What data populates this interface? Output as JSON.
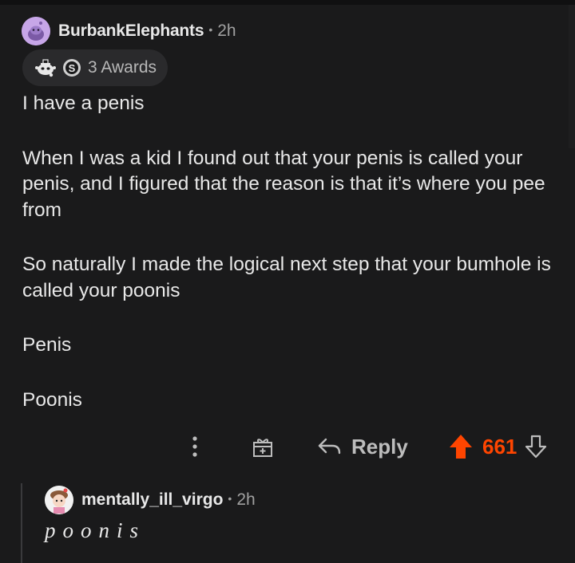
{
  "post": {
    "author": "BurbankElephants",
    "separator": "•",
    "time": "2h",
    "awards_label": "3 Awards",
    "paragraphs": [
      "I have a penis",
      "When I was a kid I found out that your penis is called your penis, and I figured that the reason is that it’s where you pee from",
      "So naturally I made the logical next step that your bumhole is called your poonis",
      "Penis",
      "Poonis"
    ]
  },
  "actions": {
    "reply_label": "Reply",
    "score": "661",
    "upvote_color": "#ff4500",
    "icons": [
      "more-icon",
      "gift-icon",
      "reply-arrow-icon",
      "upvote-icon",
      "downvote-icon"
    ]
  },
  "reply": {
    "author": "mentally_ill_virgo",
    "separator": "•",
    "time": "2h",
    "body": "poonis"
  }
}
